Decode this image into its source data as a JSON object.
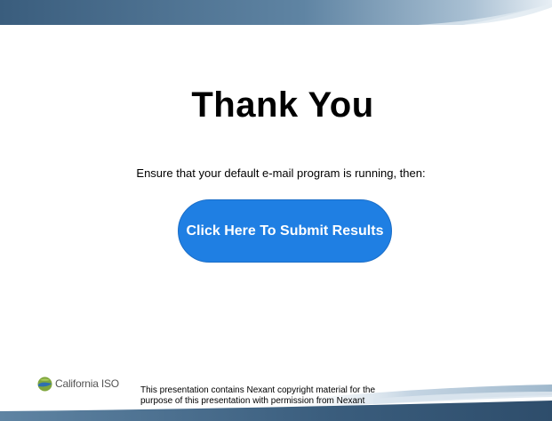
{
  "slide": {
    "title": "Thank You",
    "instruction": "Ensure that your default e-mail program is running, then:",
    "submit_button_label": "Click Here To Submit Results",
    "logo_text": "California ISO",
    "footer_line_1": "This presentation contains Nexant copyright material for the",
    "footer_line_2": "purpose of this presentation with permission from Nexant"
  },
  "colors": {
    "button": "#1f7fe3",
    "banner_dark": "#3b5e7e",
    "banner_light": "#c9d9e6"
  }
}
